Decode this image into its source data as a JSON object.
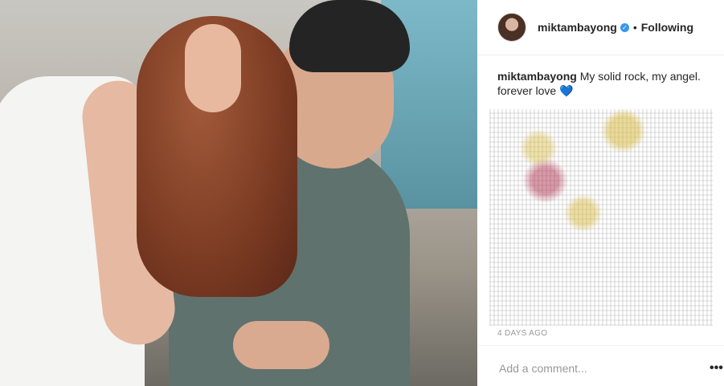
{
  "post": {
    "username": "miktambayong",
    "verified_glyph": "✓",
    "separator": "•",
    "follow_status": "Following",
    "caption_user": "miktambayong",
    "caption_text": "My solid rock, my angel. forever love",
    "caption_emoji": "💙",
    "timestamp": "4 DAYS AGO",
    "comment_placeholder": "Add a comment...",
    "more_options": "•••"
  },
  "icons": {
    "verified": "verified-badge-icon",
    "heart": "blue-heart-icon",
    "more": "more-options-icon"
  },
  "colors": {
    "accent": "#3897f0",
    "text": "#262626",
    "muted": "#999999"
  }
}
